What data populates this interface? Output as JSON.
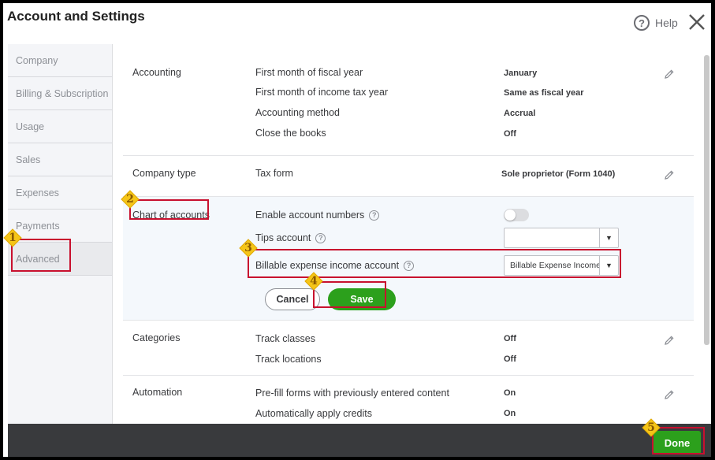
{
  "dialog": {
    "title": "Account and Settings",
    "help_label": "Help",
    "help_glyph": "?"
  },
  "sidebar": {
    "items": [
      {
        "label": "Company"
      },
      {
        "label": "Billing & Subscription"
      },
      {
        "label": "Usage"
      },
      {
        "label": "Sales"
      },
      {
        "label": "Expenses"
      },
      {
        "label": "Payments"
      },
      {
        "label": "Advanced",
        "active": true
      }
    ]
  },
  "sections": {
    "accounting": {
      "label": "Accounting",
      "rows": [
        {
          "label": "First month of fiscal year",
          "value": "January"
        },
        {
          "label": "First month of income tax year",
          "value": "Same as fiscal year"
        },
        {
          "label": "Accounting method",
          "value": "Accrual"
        },
        {
          "label": "Close the books",
          "value": "Off"
        }
      ]
    },
    "company_type": {
      "label": "Company type",
      "rows": [
        {
          "label": "Tax form",
          "value": "Sole proprietor (Form 1040)"
        }
      ]
    },
    "chart_of_accounts": {
      "label": "Chart of accounts",
      "enable_numbers_label": "Enable account numbers",
      "enable_numbers_on": false,
      "tips_label": "Tips account",
      "tips_value": "",
      "billable_label": "Billable expense income account",
      "billable_value": "Billable Expense Income",
      "dropdown_arrow": "▼",
      "cancel_label": "Cancel",
      "save_label": "Save"
    },
    "categories": {
      "label": "Categories",
      "rows": [
        {
          "label": "Track classes",
          "value": "Off"
        },
        {
          "label": "Track locations",
          "value": "Off"
        }
      ]
    },
    "automation": {
      "label": "Automation",
      "rows": [
        {
          "label": "Pre-fill forms with previously entered content",
          "value": "On"
        },
        {
          "label": "Automatically apply credits",
          "value": "On"
        }
      ]
    }
  },
  "footer": {
    "done_label": "Done"
  },
  "steps": [
    "1",
    "2",
    "3",
    "4",
    "5"
  ],
  "colors": {
    "accent_green": "#2ca01c",
    "highlight_red": "#c8102e",
    "badge_gold": "#f5c518",
    "footer_bg": "#393a3d"
  }
}
